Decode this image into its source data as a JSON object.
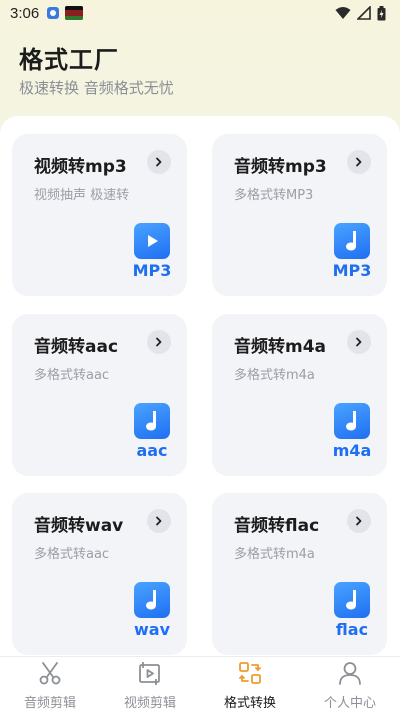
{
  "status_bar": {
    "time": "3:06"
  },
  "header": {
    "title": "格式工厂",
    "subtitle": "极速转换 音频格式无忧"
  },
  "cards": [
    {
      "title": "视频转mp3",
      "subtitle": "视频抽声 极速转",
      "badge": "play-icon",
      "label": "MP3"
    },
    {
      "title": "音频转mp3",
      "subtitle": "多格式转MP3",
      "badge": "music-note-icon",
      "label": "MP3"
    },
    {
      "title": "音频转aac",
      "subtitle": "多格式转aac",
      "badge": "music-note-icon",
      "label": "aac"
    },
    {
      "title": "音频转m4a",
      "subtitle": "多格式转m4a",
      "badge": "music-note-icon",
      "label": "m4a"
    },
    {
      "title": "音频转wav",
      "subtitle": "多格式转aac",
      "badge": "music-note-icon",
      "label": "wav"
    },
    {
      "title": "音频转flac",
      "subtitle": "多格式转m4a",
      "badge": "music-note-icon",
      "label": "flac"
    }
  ],
  "nav": [
    {
      "label": "音频剪辑",
      "icon": "scissors-icon",
      "active": false
    },
    {
      "label": "视频剪辑",
      "icon": "video-edit-icon",
      "active": false
    },
    {
      "label": "格式转换",
      "icon": "convert-icon",
      "active": true
    },
    {
      "label": "个人中心",
      "icon": "person-icon",
      "active": false
    }
  ],
  "colors": {
    "accent": "#1f6ff2",
    "nav_active": "#f29a2e",
    "nav_inactive": "#8c9096"
  }
}
